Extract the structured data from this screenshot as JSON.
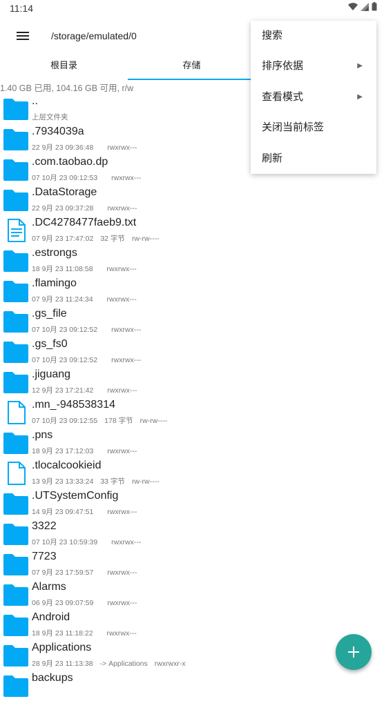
{
  "status": {
    "time": "11:14"
  },
  "appbar": {
    "path": "/storage/emulated/0"
  },
  "tabs": [
    {
      "label": "根目录"
    },
    {
      "label": "存储"
    }
  ],
  "storage_info": "1.40 GB 已用, 104.16 GB 可用, r/w",
  "files": [
    {
      "name": "..",
      "date": "上层文件夹",
      "size": "",
      "perm": "",
      "type": "folder"
    },
    {
      "name": ".7934039a",
      "date": "22 9月 23 09:36:48",
      "size": "",
      "perm": "rwxrwx---",
      "type": "folder"
    },
    {
      "name": ".com.taobao.dp",
      "date": "07 10月 23 09:12:53",
      "size": "",
      "perm": "rwxrwx---",
      "type": "folder"
    },
    {
      "name": ".DataStorage",
      "date": "22 9月 23 09:37:28",
      "size": "",
      "perm": "rwxrwx---",
      "type": "folder"
    },
    {
      "name": ".DC4278477faeb9.txt",
      "date": "07 9月 23 17:47:02",
      "size": "32 字节",
      "perm": "rw-rw----",
      "type": "text"
    },
    {
      "name": ".estrongs",
      "date": "18 9月 23 11:08:58",
      "size": "",
      "perm": "rwxrwx---",
      "type": "folder"
    },
    {
      "name": ".flamingo",
      "date": "07 9月 23 11:24:34",
      "size": "",
      "perm": "rwxrwx---",
      "type": "folder"
    },
    {
      "name": ".gs_file",
      "date": "07 10月 23 09:12:52",
      "size": "",
      "perm": "rwxrwx---",
      "type": "folder"
    },
    {
      "name": ".gs_fs0",
      "date": "07 10月 23 09:12:52",
      "size": "",
      "perm": "rwxrwx---",
      "type": "folder"
    },
    {
      "name": ".jiguang",
      "date": "12 9月 23 17:21:42",
      "size": "",
      "perm": "rwxrwx---",
      "type": "folder"
    },
    {
      "name": ".mn_-948538314",
      "date": "07 10月 23 09:12:55",
      "size": "178 字节",
      "perm": "rw-rw----",
      "type": "file"
    },
    {
      "name": ".pns",
      "date": "18 9月 23 17:12:03",
      "size": "",
      "perm": "rwxrwx---",
      "type": "folder"
    },
    {
      "name": ".tlocalcookieid",
      "date": "13 9月 23 13:33:24",
      "size": "33 字节",
      "perm": "rw-rw----",
      "type": "file"
    },
    {
      "name": ".UTSystemConfig",
      "date": "14 9月 23 09:47:51",
      "size": "",
      "perm": "rwxrwx---",
      "type": "folder"
    },
    {
      "name": "3322",
      "date": "07 10月 23 10:59:39",
      "size": "",
      "perm": "rwxrwx---",
      "type": "folder"
    },
    {
      "name": "7723",
      "date": "07 9月 23 17:59:57",
      "size": "",
      "perm": "rwxrwx---",
      "type": "folder"
    },
    {
      "name": "Alarms",
      "date": "06 9月 23 09:07:59",
      "size": "",
      "perm": "rwxrwx---",
      "type": "folder"
    },
    {
      "name": "Android",
      "date": "18 9月 23 11:18:22",
      "size": "",
      "perm": "rwxrwx---",
      "type": "folder"
    },
    {
      "name": "Applications",
      "date": "28 9月 23 11:13:38",
      "size": "-> Applications",
      "perm": "rwxrwxr-x",
      "type": "folder"
    },
    {
      "name": "backups",
      "date": "",
      "size": "",
      "perm": "",
      "type": "folder"
    }
  ],
  "menu": [
    {
      "label": "搜索",
      "submenu": false
    },
    {
      "label": "排序依据",
      "submenu": true
    },
    {
      "label": "查看模式",
      "submenu": true
    },
    {
      "label": "关闭当前标签",
      "submenu": false
    },
    {
      "label": "刷新",
      "submenu": false
    }
  ],
  "colors": {
    "accent": "#03a9f4",
    "folder": "#03a9f4",
    "fab": "#26a69a"
  },
  "icons": {
    "menu": "hamburger-icon",
    "folder": "folder-icon",
    "text": "text-file-icon",
    "file": "file-icon",
    "add": "plus-icon",
    "submenu": "submenu-arrow-icon"
  }
}
